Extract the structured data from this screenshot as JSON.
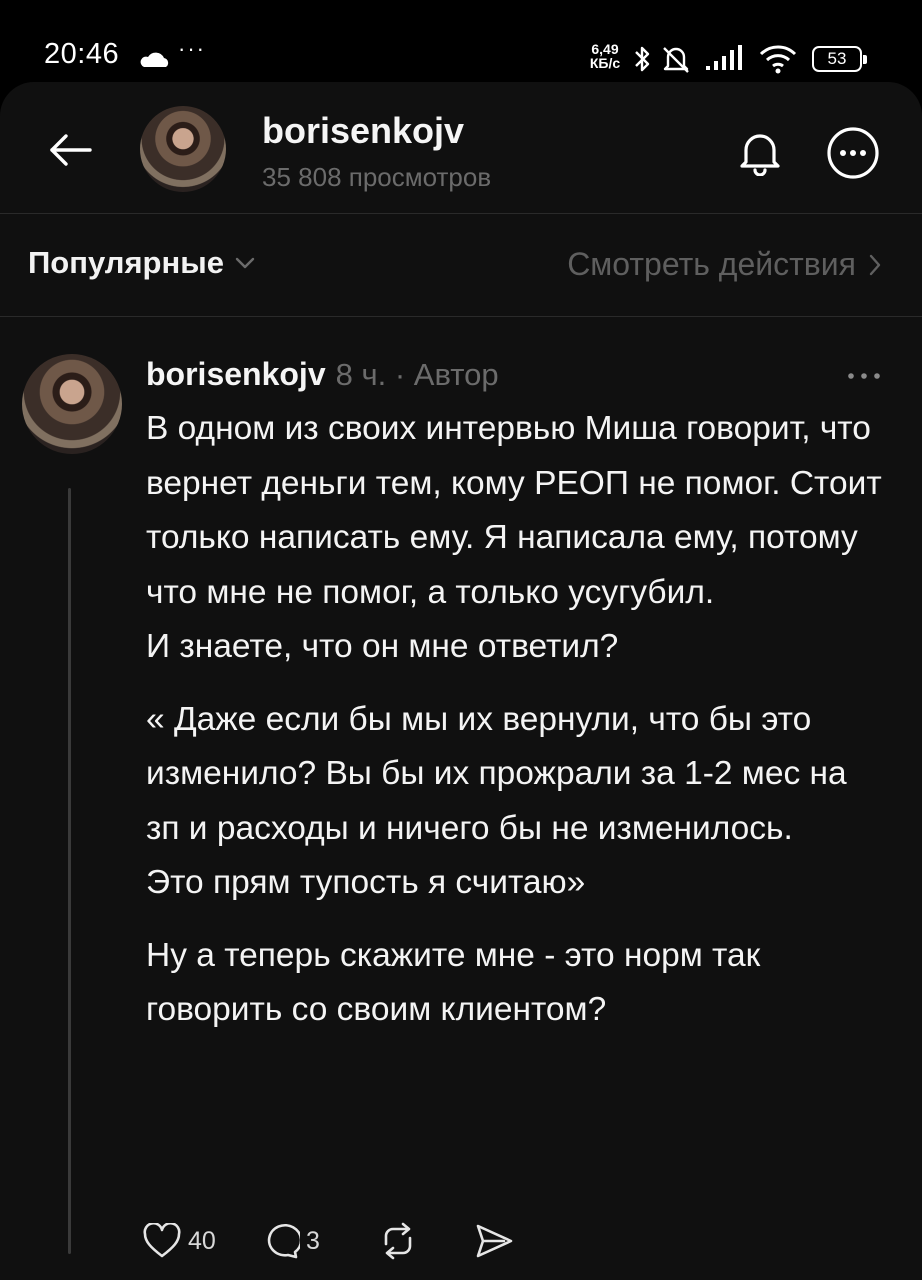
{
  "status_bar": {
    "time": "20:46",
    "dots": "···",
    "net_speed_value": "6,49",
    "net_speed_unit": "КБ/с",
    "battery": "53"
  },
  "header": {
    "username": "borisenkojv",
    "views": "35 808 просмотров"
  },
  "sort_bar": {
    "sort_label": "Популярные",
    "actions_label": "Смотреть действия"
  },
  "post": {
    "author": "borisenkojv",
    "meta": "8 ч. · Автор",
    "paragraphs": [
      "В одном из своих интервью Миша говорит, что вернет деньги тем, кому РЕОП не помог. Стоит только написать ему. Я написала ему, потому что мне не помог, а только усугубил.\n И знаете, что он мне ответил?",
      "« Даже если бы мы их вернули, что бы это изменило? Вы бы их прожрали за 1-2 мес на зп и расходы и ничего бы не изменилось.\nЭто прям тупость я считаю»",
      "Ну а теперь скажите мне - это норм так говорить со своим клиентом?"
    ],
    "likes": "40",
    "replies": "3"
  },
  "icons": {
    "back": "arrow-left-icon",
    "bell": "bell-icon",
    "more": "more-icon",
    "like": "heart-icon",
    "reply": "comment-icon",
    "repost": "repost-icon",
    "share": "send-icon"
  }
}
